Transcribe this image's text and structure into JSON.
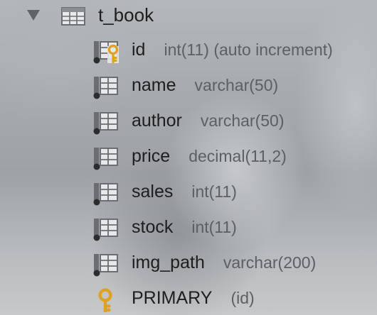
{
  "table": {
    "name": "t_book",
    "expanded": true
  },
  "columns": [
    {
      "name": "id",
      "type": "int(11) (auto increment)",
      "icon": "primary-key-column-icon"
    },
    {
      "name": "name",
      "type": "varchar(50)",
      "icon": "column-icon"
    },
    {
      "name": "author",
      "type": "varchar(50)",
      "icon": "column-icon"
    },
    {
      "name": "price",
      "type": "decimal(11,2)",
      "icon": "column-icon"
    },
    {
      "name": "sales",
      "type": "int(11)",
      "icon": "column-icon"
    },
    {
      "name": "stock",
      "type": "int(11)",
      "icon": "column-icon"
    },
    {
      "name": "img_path",
      "type": "varchar(200)",
      "icon": "column-icon"
    }
  ],
  "keys": [
    {
      "name": "PRIMARY",
      "columns": "(id)",
      "icon": "key-icon"
    }
  ],
  "colors": {
    "key": "#e0a020",
    "icon_grid": "#6a6e72",
    "text": "#1c1e20",
    "type_text": "#5c6064"
  }
}
